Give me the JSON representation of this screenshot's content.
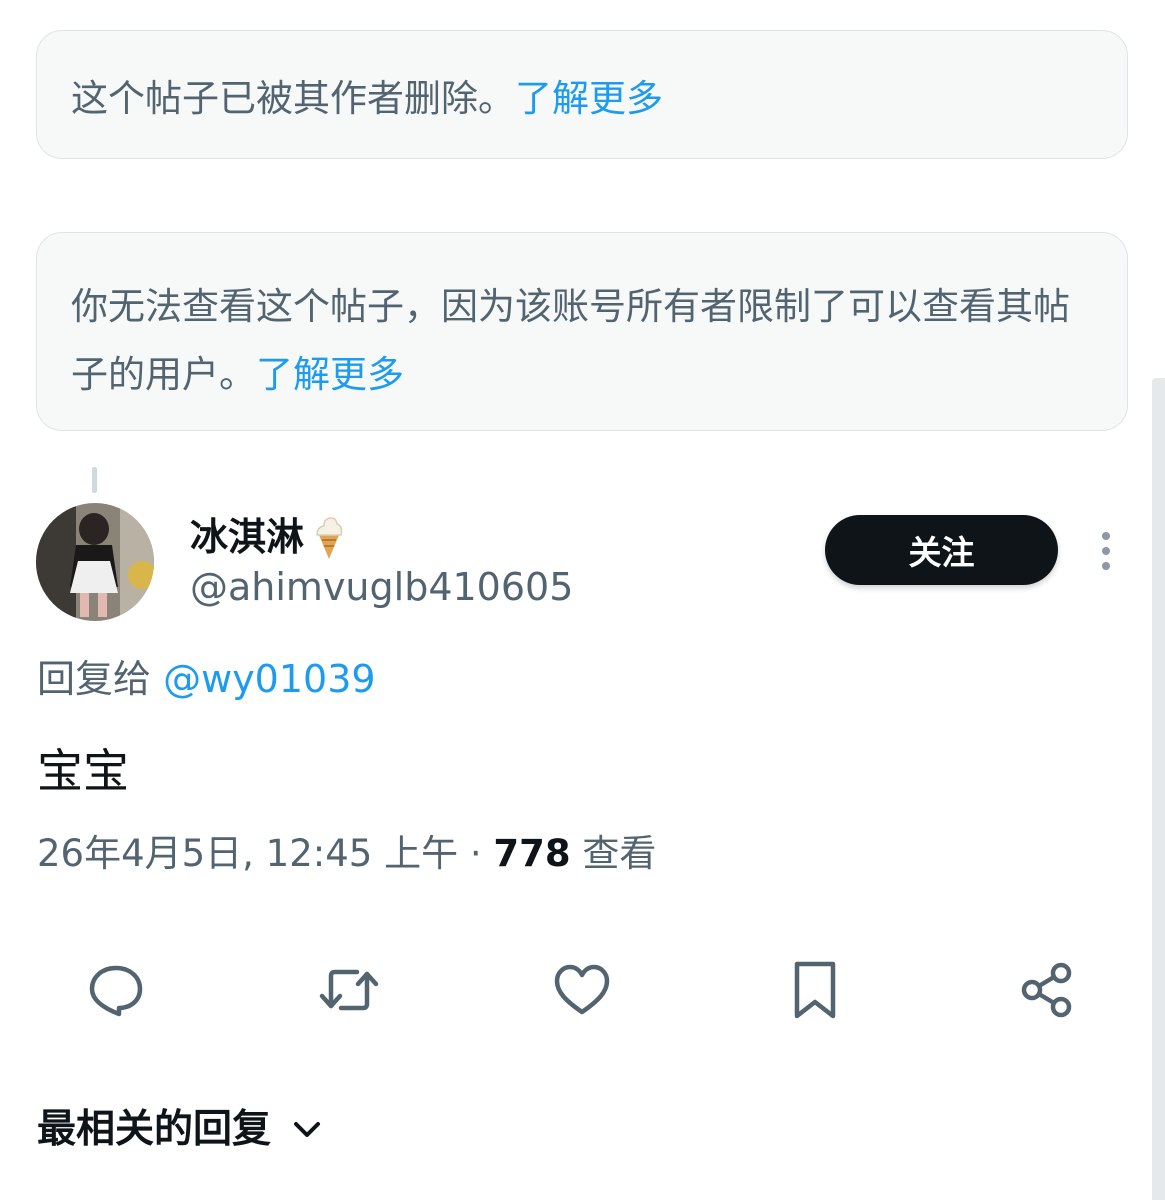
{
  "notices": [
    {
      "text": "这个帖子已被其作者删除。",
      "link": "了解更多"
    },
    {
      "text": "你无法查看这个帖子，因为该账号所有者限制了可以查看其帖子的用户。",
      "link": "了解更多"
    }
  ],
  "post": {
    "display_name": "冰淇淋",
    "name_emoji": "soft-ice-cream-icon",
    "handle": "@ahimvuglb410605",
    "follow_label": "关注",
    "reply_to_prefix": "回复给",
    "reply_to_handle": "@wy01039",
    "text": "宝宝",
    "timestamp": "26年4月5日, 12:45 上午",
    "separator": "·",
    "views_count": "778",
    "views_label": "查看"
  },
  "actions": [
    "reply-icon",
    "repost-icon",
    "like-icon",
    "bookmark-icon",
    "share-icon"
  ],
  "replies_sort": {
    "label": "最相关的回复",
    "icon": "chevron-down-icon"
  },
  "colors": {
    "link": "#1d9bf0",
    "secondary_text": "#536471",
    "primary_text": "#0f1419",
    "notice_bg": "#f7f9f9",
    "follow_bg": "#0f1419"
  }
}
